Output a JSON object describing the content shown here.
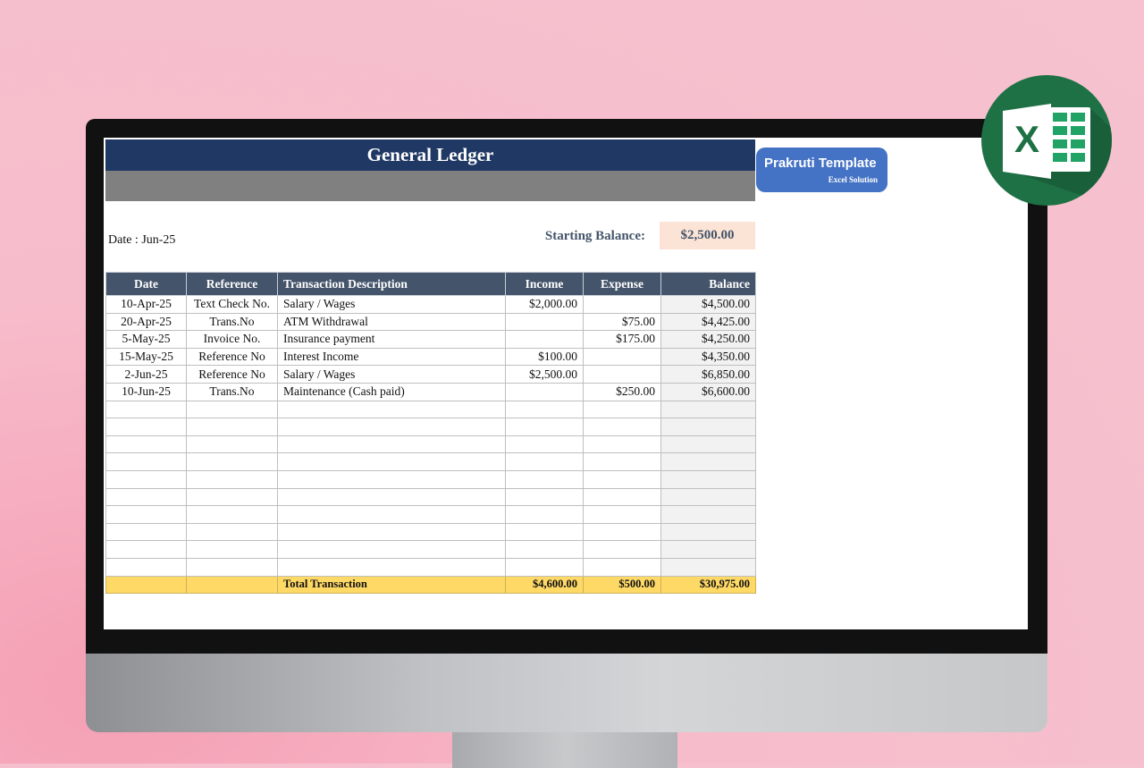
{
  "sheet": {
    "title": "General Ledger",
    "date_label": "Date : Jun-25",
    "starting_balance_label": "Starting Balance:",
    "starting_balance_value": "$2,500.00"
  },
  "brand": {
    "name": "Prakruti Template",
    "subtitle": "Excel Solution"
  },
  "excel_logo": {
    "letter": "X",
    "icon": "excel-icon",
    "color": "#1e7145"
  },
  "table": {
    "headers": [
      "Date",
      "Reference",
      "Transaction Description",
      "Income",
      "Expense",
      "Balance"
    ],
    "rows": [
      [
        "10-Apr-25",
        "Text Check No.",
        "Salary / Wages",
        "$2,000.00",
        "",
        "$4,500.00"
      ],
      [
        "20-Apr-25",
        "Trans.No",
        "ATM Withdrawal",
        "",
        "$75.00",
        "$4,425.00"
      ],
      [
        "5-May-25",
        "Invoice No.",
        "Insurance payment",
        "",
        "$175.00",
        "$4,250.00"
      ],
      [
        "15-May-25",
        "Reference No",
        "Interest Income",
        "$100.00",
        "",
        "$4,350.00"
      ],
      [
        "2-Jun-25",
        "Reference No",
        "Salary / Wages",
        "$2,500.00",
        "",
        "$6,850.00"
      ],
      [
        "10-Jun-25",
        "Trans.No",
        "Maintenance (Cash paid)",
        "",
        "$250.00",
        "$6,600.00"
      ],
      [
        "",
        "",
        "",
        "",
        "",
        ""
      ],
      [
        "",
        "",
        "",
        "",
        "",
        ""
      ],
      [
        "",
        "",
        "",
        "",
        "",
        ""
      ],
      [
        "",
        "",
        "",
        "",
        "",
        ""
      ],
      [
        "",
        "",
        "",
        "",
        "",
        ""
      ],
      [
        "",
        "",
        "",
        "",
        "",
        ""
      ],
      [
        "",
        "",
        "",
        "",
        "",
        ""
      ],
      [
        "",
        "",
        "",
        "",
        "",
        ""
      ],
      [
        "",
        "",
        "",
        "",
        "",
        ""
      ],
      [
        "",
        "",
        "",
        "",
        "",
        ""
      ]
    ],
    "total": {
      "label": "Total Transaction",
      "income": "$4,600.00",
      "expense": "$500.00",
      "balance": "$30,975.00"
    }
  },
  "colors": {
    "title_bar": "#203864",
    "header_row": "#44546a",
    "total_row": "#ffd966",
    "starting_balance_bg": "#fbe4d5",
    "brand": "#4472c4"
  }
}
